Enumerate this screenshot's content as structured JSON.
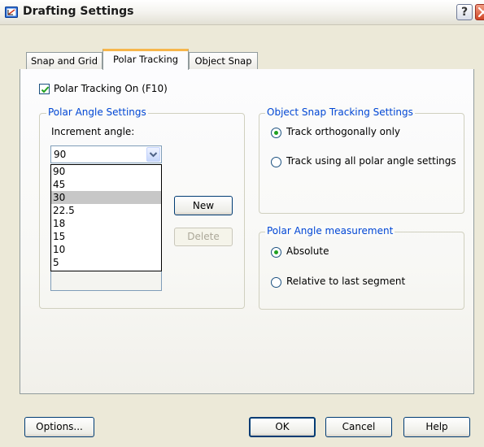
{
  "window": {
    "title": "Drafting Settings",
    "help_glyph": "?"
  },
  "tabs": [
    {
      "label": "Snap and Grid",
      "active": false
    },
    {
      "label": "Polar Tracking",
      "active": true
    },
    {
      "label": "Object Snap",
      "active": false
    }
  ],
  "polar": {
    "toggle_label": "Polar Tracking On (F10)",
    "checked": true,
    "group_title": "Polar Angle Settings",
    "increment_label": "Increment angle:",
    "increment_value": "90",
    "options": [
      "90",
      "45",
      "30",
      "22.5",
      "18",
      "15",
      "10",
      "5"
    ],
    "highlighted_option": "30",
    "new_label": "New",
    "delete_label": "Delete"
  },
  "tracking": {
    "group_title": "Object Snap Tracking Settings",
    "option_ortho": "Track orthogonally only",
    "option_all": "Track using all polar angle settings",
    "selected": "Track orthogonally only"
  },
  "measurement": {
    "group_title": "Polar Angle measurement",
    "option_absolute": "Absolute",
    "option_relative": "Relative to last segment",
    "selected": "Absolute"
  },
  "footer": {
    "options_label": "Options...",
    "ok_label": "OK",
    "cancel_label": "Cancel",
    "help_label": "Help"
  },
  "icons": [
    "dialog-app-icon",
    "help-icon",
    "close-icon",
    "checkmark-icon",
    "chevron-down-icon"
  ],
  "colors": {
    "accent": "#0046d5",
    "active_tab_top": "#f7b64b",
    "radio_dot": "#21a121",
    "close_button": "#cf4525"
  }
}
